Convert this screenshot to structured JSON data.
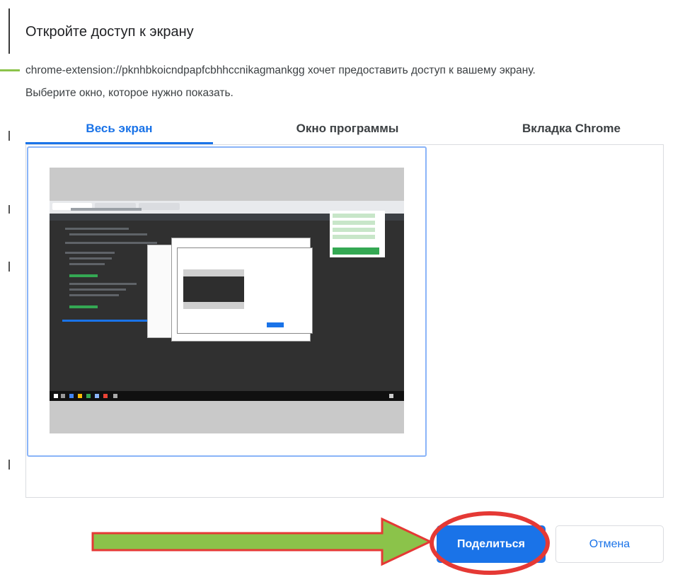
{
  "dialog": {
    "title": "Откройте доступ к экрану",
    "description_line1": "chrome-extension://pknhbkoicndpapfcbhhccnikagmankgg хочет предоставить доступ к вашему экрану.",
    "description_line2": "Выберите окно, которое нужно показать."
  },
  "tabs": [
    {
      "label": "Весь экран",
      "active": true
    },
    {
      "label": "Окно программы",
      "active": false
    },
    {
      "label": "Вкладка Chrome",
      "active": false
    }
  ],
  "buttons": {
    "share": "Поделиться",
    "cancel": "Отмена"
  },
  "colors": {
    "accent": "#1a73e8",
    "annotation_arrow_fill": "#8bc34a",
    "annotation_arrow_border": "#e53935",
    "annotation_circle": "#e53935"
  },
  "annotations": {
    "arrow_icon": "right-arrow-icon",
    "circle_icon": "highlight-circle-icon"
  }
}
